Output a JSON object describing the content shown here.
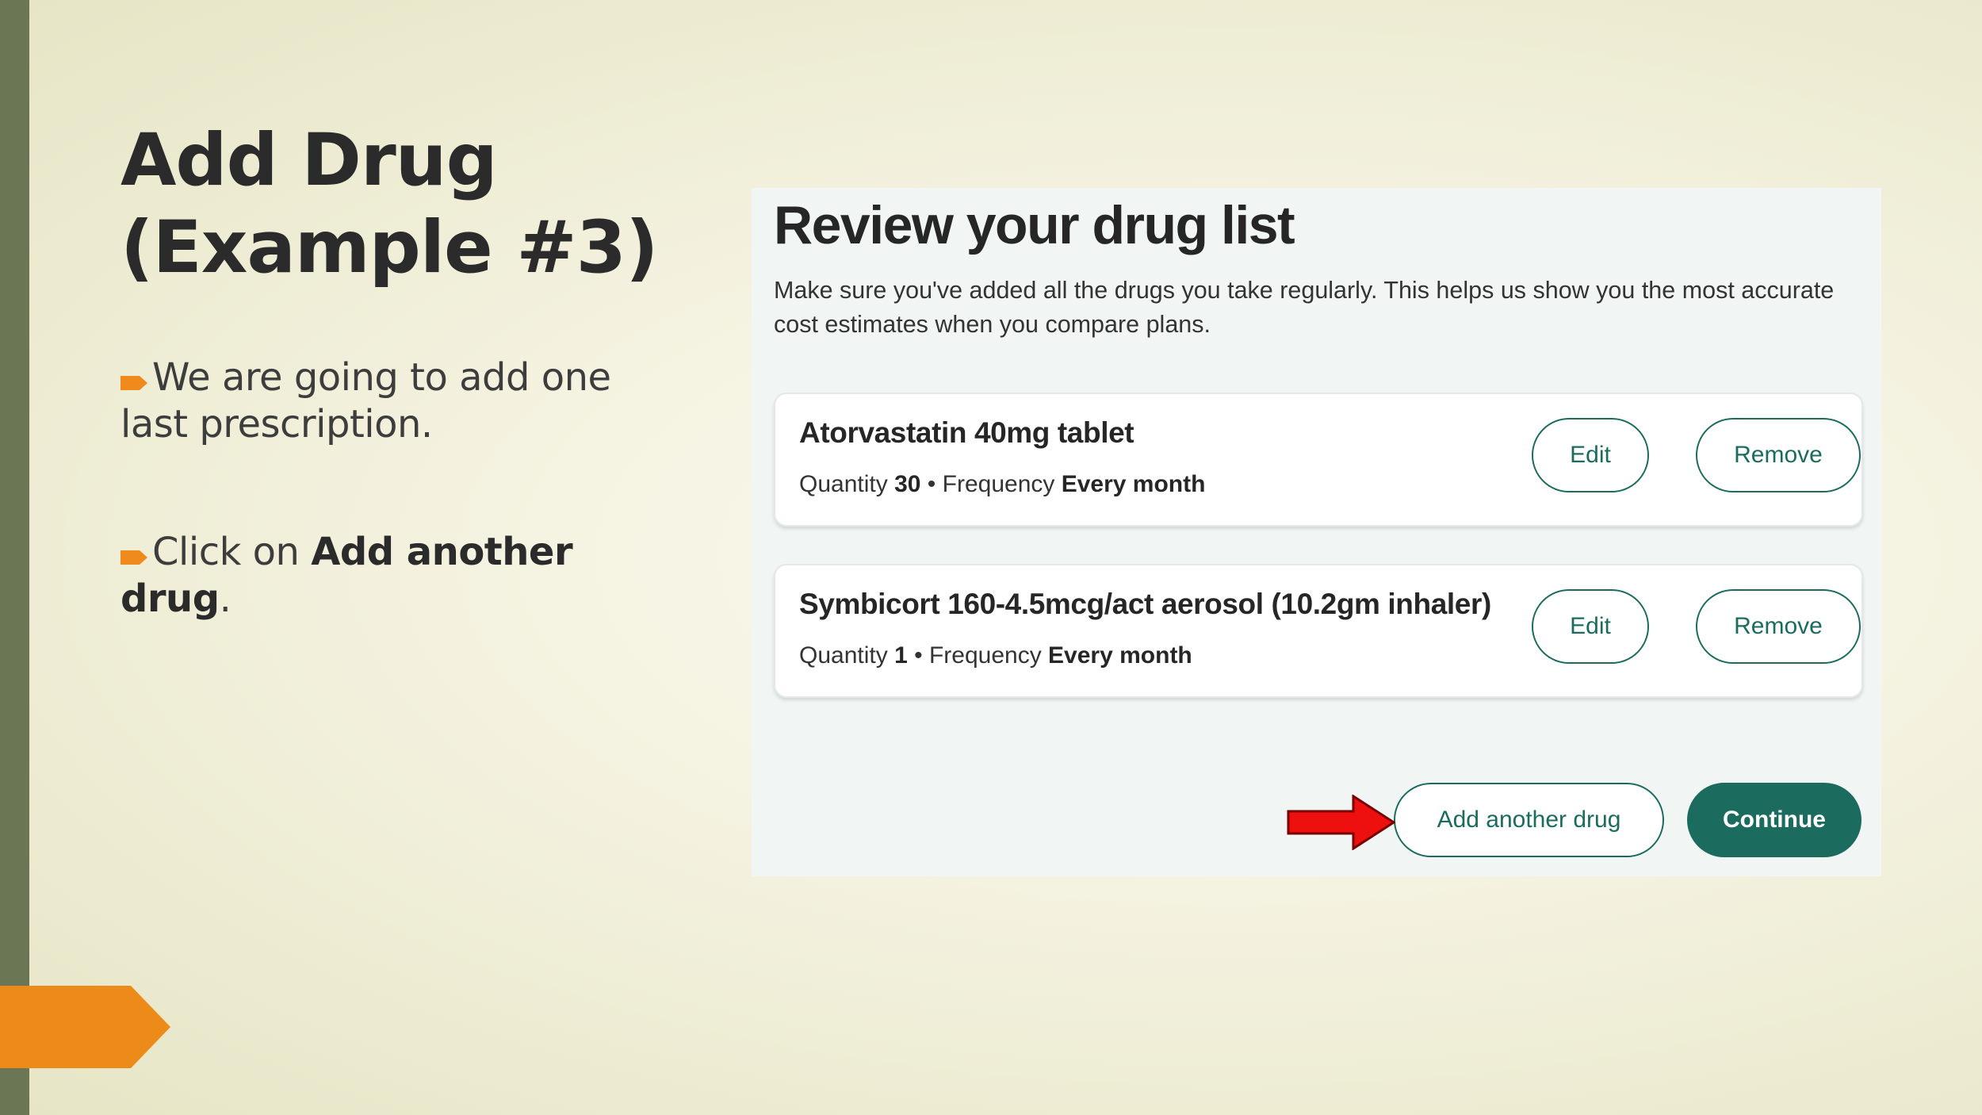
{
  "slide": {
    "title_line1": "Add Drug",
    "title_line2": "(Example #3)",
    "bullet1": "We are going to add one last prescription.",
    "bullet2_prefix": "Click on ",
    "bullet2_bold": "Add another drug",
    "bullet2_suffix": ".",
    "accent_color": "#f08a1c",
    "sidebar_color": "#6b7754"
  },
  "panel": {
    "title": "Review your drug list",
    "description": "Make sure you've added all the drugs you take regularly. This helps us show you the most accurate cost estimates when you compare plans.",
    "drugs": [
      {
        "name": "Atorvastatin 40mg tablet",
        "quantity_label": "Quantity",
        "quantity": "30",
        "separator": " • ",
        "frequency_label": "Frequency",
        "frequency": "Every month",
        "edit_label": "Edit",
        "remove_label": "Remove"
      },
      {
        "name": "Symbicort 160-4.5mcg/act aerosol (10.2gm inhaler)",
        "quantity_label": "Quantity",
        "quantity": "1",
        "separator": " • ",
        "frequency_label": "Frequency",
        "frequency": "Every month",
        "edit_label": "Edit",
        "remove_label": "Remove"
      }
    ],
    "add_another_label": "Add another drug",
    "continue_label": "Continue",
    "brand_color": "#1b6b5e"
  },
  "icons": {
    "pointer": "red-arrow-icon",
    "bullet": "orange-arrow-bullet-icon"
  }
}
